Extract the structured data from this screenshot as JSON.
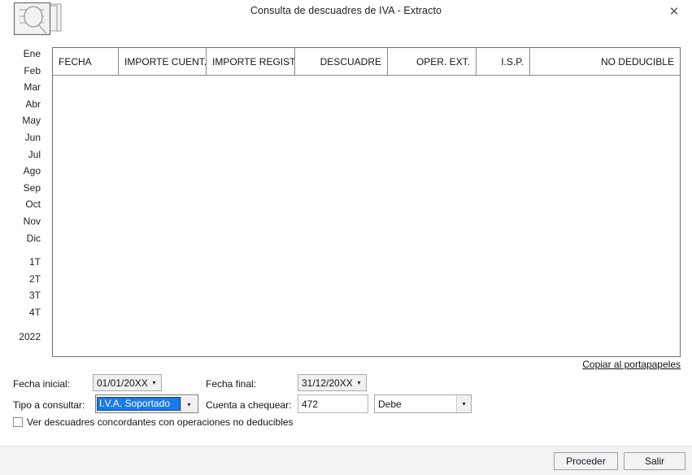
{
  "window": {
    "title": "Consulta de descuadres de IVA - Extracto",
    "close_label": "✕",
    "icon": "document-search-icon"
  },
  "sidebar": {
    "months": [
      {
        "label": "Ene"
      },
      {
        "label": "Feb"
      },
      {
        "label": "Mar"
      },
      {
        "label": "Abr"
      },
      {
        "label": "May"
      },
      {
        "label": "Jun"
      },
      {
        "label": "Jul"
      },
      {
        "label": "Ago"
      },
      {
        "label": "Sep"
      },
      {
        "label": "Oct"
      },
      {
        "label": "Nov"
      },
      {
        "label": "Dic"
      }
    ],
    "quarters": [
      {
        "label": "1T"
      },
      {
        "label": "2T"
      },
      {
        "label": "3T"
      },
      {
        "label": "4T"
      }
    ],
    "year": {
      "label": "2022"
    }
  },
  "grid": {
    "columns": [
      {
        "label": "FECHA",
        "align": "l",
        "width": 81
      },
      {
        "label": "IMPORTE CUENT...",
        "align": "l",
        "width": 108
      },
      {
        "label": "IMPORTE REGIST...",
        "align": "l",
        "width": 109
      },
      {
        "label": "DESCUADRE",
        "align": "r",
        "width": 114
      },
      {
        "label": "OPER. EXT.",
        "align": "r",
        "width": 109
      },
      {
        "label": "I.S.P.",
        "align": "r",
        "width": 66
      },
      {
        "label": "NO DEDUCIBLE",
        "align": "r",
        "width": 184
      }
    ],
    "rows": []
  },
  "actions": {
    "copy_clipboard": "Copiar al portapapeles"
  },
  "form": {
    "fecha_inicial_label": "Fecha inicial:",
    "fecha_inicial_value": "01/01/20XX",
    "fecha_final_label": "Fecha final:",
    "fecha_final_value": "31/12/20XX",
    "tipo_label": "Tipo a consultar:",
    "tipo_value": "I.V.A. Soportado",
    "cuenta_label": "Cuenta a chequear:",
    "cuenta_value": "472",
    "debe_haber_value": "Debe",
    "checkbox_label": "Ver descuadres concordantes con operaciones no deducibles",
    "dropdown_arrow": "▾"
  },
  "footer": {
    "proceder_label": "Proceder",
    "salir_label": "Salir"
  },
  "colors": {
    "accent": "#1a7ae8",
    "border": "#6d6d6d",
    "footer_bg": "#f3f3f3"
  }
}
